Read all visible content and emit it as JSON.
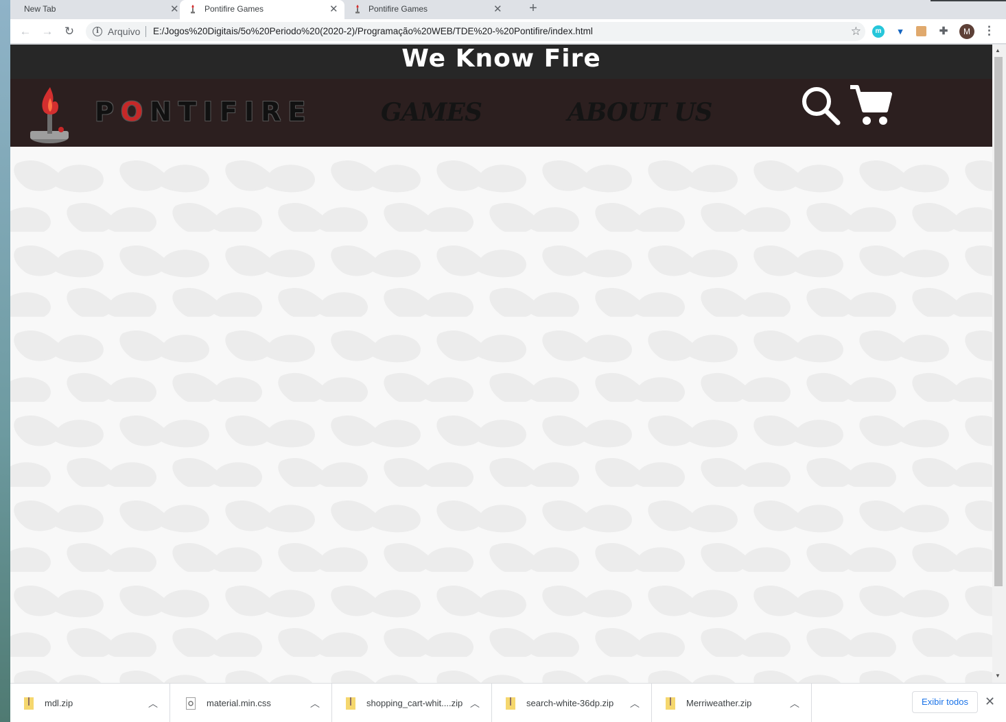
{
  "browser": {
    "tabs": [
      {
        "title": "New Tab",
        "active": false
      },
      {
        "title": "Pontifire Games",
        "active": true
      },
      {
        "title": "Pontifire Games",
        "active": false
      }
    ],
    "new_tab_symbol": "+",
    "close_symbol": "✕",
    "address": {
      "scheme_label": "Arquivo",
      "url": "E:/Jogos%20Digitais/5o%20Periodo%20(2020-2)/Programação%20WEB/TDE%20-%20Pontifire/index.html"
    },
    "profile_initial": "M",
    "extensions": [
      "m-extension-icon",
      "vpn-extension-icon",
      "notes-extension-icon",
      "puzzle-extensions-icon"
    ]
  },
  "site": {
    "tagline": "We Know Fire",
    "logo_text_before": "P",
    "logo_text_o": "O",
    "logo_text_after": "NTIFIRE",
    "nav": {
      "games": "GAMES",
      "about": "ABOUT US"
    },
    "colors": {
      "topbar": "#272727",
      "navbar": "#2c1f1f",
      "accent_fire": "#c62828"
    }
  },
  "downloads": {
    "items": [
      {
        "name": "mdl.zip",
        "type": "zip"
      },
      {
        "name": "material.min.css",
        "type": "css"
      },
      {
        "name": "shopping_cart-whit....zip",
        "type": "zip"
      },
      {
        "name": "search-white-36dp.zip",
        "type": "zip"
      },
      {
        "name": "Merriweather.zip",
        "type": "zip"
      }
    ],
    "show_all_label": "Exibir todos"
  }
}
